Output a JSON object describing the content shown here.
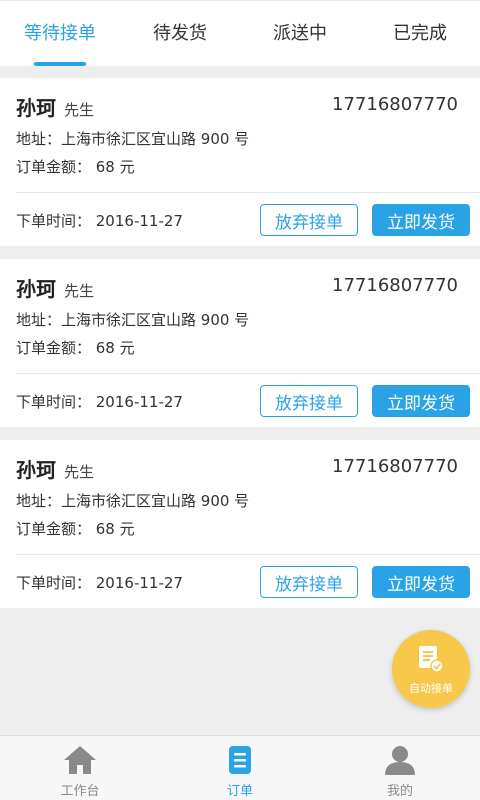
{
  "tabs": [
    {
      "label": "等待接单",
      "active": true
    },
    {
      "label": "待发货",
      "active": false
    },
    {
      "label": "派送中",
      "active": false
    },
    {
      "label": "已完成",
      "active": false
    }
  ],
  "orders": [
    {
      "name": "孙珂",
      "title": "先生",
      "phone": "17716807770",
      "address": "地址：上海市徐汇区宜山路 900 号",
      "amount": "订单金额： 68 元",
      "time": "下单时间： 2016-11-27",
      "abandon_label": "放弃接单",
      "ship_label": "立即发货"
    },
    {
      "name": "孙珂",
      "title": "先生",
      "phone": "17716807770",
      "address": "地址：上海市徐汇区宜山路 900 号",
      "amount": "订单金额： 68 元",
      "time": "下单时间： 2016-11-27",
      "abandon_label": "放弃接单",
      "ship_label": "立即发货"
    },
    {
      "name": "孙珂",
      "title": "先生",
      "phone": "17716807770",
      "address": "地址：上海市徐汇区宜山路 900 号",
      "amount": "订单金额： 68 元",
      "time": "下单时间： 2016-11-27",
      "abandon_label": "放弃接单",
      "ship_label": "立即发货"
    }
  ],
  "fab": {
    "label": "自动接单",
    "icon": "document-check-icon"
  },
  "bottom_nav": [
    {
      "label": "工作台",
      "icon": "home-icon",
      "active": false
    },
    {
      "label": "订单",
      "icon": "order-document-icon",
      "active": true
    },
    {
      "label": "我的",
      "icon": "user-icon",
      "active": false
    }
  ],
  "colors": {
    "accent": "#2aa3e6",
    "fab": "#f8c84a",
    "background": "#eeeeee"
  }
}
